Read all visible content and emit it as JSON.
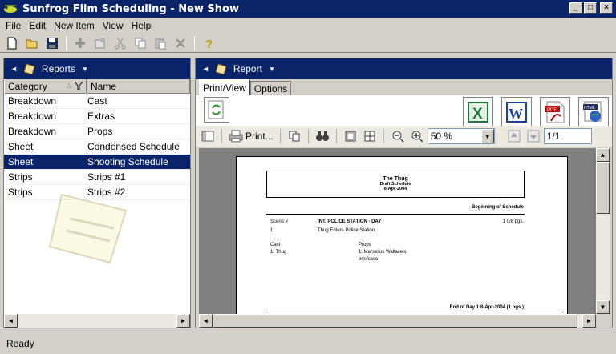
{
  "window": {
    "title": "Sunfrog Film Scheduling - New Show"
  },
  "menu": [
    {
      "label": "File",
      "ul": "F",
      "rest": "ile"
    },
    {
      "label": "Edit",
      "ul": "E",
      "rest": "dit"
    },
    {
      "label": "New Item",
      "ul": "N",
      "rest": "ew Item"
    },
    {
      "label": "View",
      "ul": "V",
      "rest": "iew"
    },
    {
      "label": "Help",
      "ul": "H",
      "rest": "elp"
    }
  ],
  "left_pane": {
    "header": "Reports",
    "columns": {
      "category": "Category",
      "name": "Name"
    },
    "rows": [
      {
        "category": "Breakdown",
        "name": "Cast"
      },
      {
        "category": "Breakdown",
        "name": "Extras"
      },
      {
        "category": "Breakdown",
        "name": "Props"
      },
      {
        "category": "Sheet",
        "name": "Condensed Schedule"
      },
      {
        "category": "Sheet",
        "name": "Shooting Schedule"
      },
      {
        "category": "Strips",
        "name": "Strips #1"
      },
      {
        "category": "Strips",
        "name": "Strips #2"
      }
    ],
    "selected_row": 4
  },
  "right_pane": {
    "header": "Report",
    "tabs": [
      "Print/View",
      "Options"
    ],
    "active_tab": 0,
    "print_label": "Print...",
    "zoom": "50 %",
    "page": "1/1",
    "export_buttons": [
      "excel-icon",
      "word-icon",
      "pdf-icon",
      "html-icon"
    ]
  },
  "report": {
    "title": "The Thug",
    "subtitle": "Draft Schedule",
    "date": "8-Apr-2004",
    "section": "Beginning of Schedule",
    "scene_label": "Scene #",
    "scene_no": "1",
    "heading": "INT. POLICE STATION - DAY",
    "pages": "1 0/8 pgs.",
    "description": "Thug Enters Police Station",
    "cast_label": "Cast",
    "cast": "1. Thug",
    "props_label": "Props",
    "props1": "1. Marsellus Wallace's",
    "props2": "briefcase",
    "end": "End of Day 1:8-Apr-2004 (1 pgs.)"
  },
  "status": "Ready"
}
